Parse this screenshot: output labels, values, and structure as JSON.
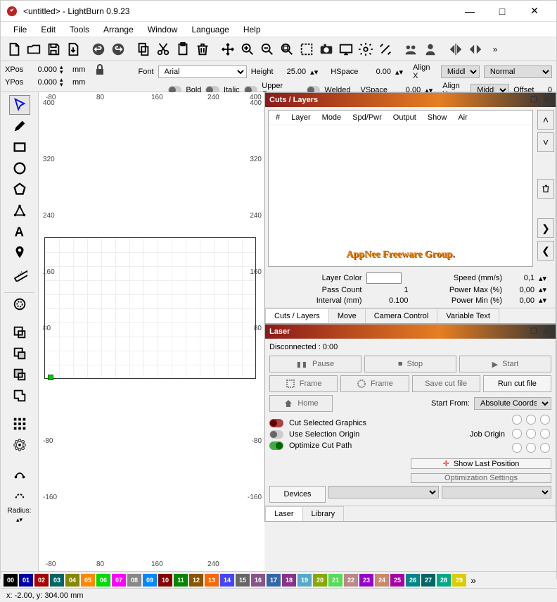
{
  "window": {
    "title": "<untitled> - LightBurn 0.9.23",
    "min": "—",
    "max": "□",
    "close": "✕"
  },
  "menu": [
    "File",
    "Edit",
    "Tools",
    "Arrange",
    "Window",
    "Language",
    "Help"
  ],
  "props": {
    "xpos_label": "XPos",
    "xpos_val": "0.000",
    "ypos_label": "YPos",
    "ypos_val": "0.000",
    "unit": "mm",
    "font_label": "Font",
    "font_value": "Arial",
    "height_label": "Height",
    "height_value": "25.00",
    "hspace_label": "HSpace",
    "hspace_value": "0.00",
    "vspace_label": "VSpace",
    "vspace_value": "0.00",
    "alignx_label": "Align X",
    "alignx_value": "Middle",
    "aligny_label": "Align Y",
    "aligny_value": "Middle",
    "normal": "Normal",
    "offset_label": "Offset",
    "offset_value": "0",
    "bold": "Bold",
    "italic": "Italic",
    "upper": "Upper Case",
    "welded": "Welded"
  },
  "palette_radius": "Radius:",
  "ruler_x": [
    "-80",
    "80",
    "160",
    "240",
    "400"
  ],
  "ruler_y_left": [
    "400",
    "320",
    "240",
    "160",
    "80",
    "",
    "-80",
    "-160"
  ],
  "ruler_y_right": [
    "400",
    "320",
    "240",
    "160",
    "80",
    "",
    "-80",
    "-160"
  ],
  "cuts": {
    "title": "Cuts / Layers",
    "headers": [
      "#",
      "Layer",
      "Mode",
      "Spd/Pwr",
      "Output",
      "Show",
      "Air"
    ],
    "watermark": "AppNee Freeware Group.",
    "layer_color": "Layer Color",
    "speed": "Speed (mm/s)",
    "speed_val": "0,1",
    "pass_count": "Pass Count",
    "pass_val": "1",
    "power_max": "Power Max (%)",
    "power_max_val": "0,00",
    "interval": "Interval (mm)",
    "interval_val": "0.100",
    "power_min": "Power Min (%)",
    "power_min_val": "0,00",
    "tabs": [
      "Cuts / Layers",
      "Move",
      "Camera Control",
      "Variable Text"
    ]
  },
  "laser": {
    "title": "Laser",
    "status": "Disconnected : 0:00",
    "pause": "Pause",
    "stop": "Stop",
    "start": "Start",
    "frame1": "Frame",
    "frame2": "Frame",
    "save_cut": "Save cut file",
    "run_cut": "Run cut file",
    "home": "Home",
    "start_from": "Start From:",
    "start_from_val": "Absolute Coords",
    "job_origin": "Job Origin",
    "cut_selected": "Cut Selected Graphics",
    "use_selection": "Use Selection Origin",
    "show_last": "Show Last Position",
    "optimize": "Optimize Cut Path",
    "opt_settings": "Optimization Settings",
    "devices": "Devices",
    "tabs": [
      "Laser",
      "Library"
    ]
  },
  "colors": [
    {
      "n": "00",
      "c": "#000"
    },
    {
      "n": "01",
      "c": "#00a"
    },
    {
      "n": "02",
      "c": "#a00"
    },
    {
      "n": "03",
      "c": "#066"
    },
    {
      "n": "04",
      "c": "#880"
    },
    {
      "n": "05",
      "c": "#f80"
    },
    {
      "n": "06",
      "c": "#0d0"
    },
    {
      "n": "07",
      "c": "#f0f"
    },
    {
      "n": "08",
      "c": "#888"
    },
    {
      "n": "09",
      "c": "#08f"
    },
    {
      "n": "10",
      "c": "#800"
    },
    {
      "n": "11",
      "c": "#080"
    },
    {
      "n": "12",
      "c": "#850"
    },
    {
      "n": "13",
      "c": "#f60"
    },
    {
      "n": "14",
      "c": "#44f"
    },
    {
      "n": "15",
      "c": "#666"
    },
    {
      "n": "16",
      "c": "#858"
    },
    {
      "n": "17",
      "c": "#36a"
    },
    {
      "n": "18",
      "c": "#838"
    },
    {
      "n": "19",
      "c": "#5ac"
    },
    {
      "n": "20",
      "c": "#8a0"
    },
    {
      "n": "21",
      "c": "#5d5"
    },
    {
      "n": "22",
      "c": "#b88"
    },
    {
      "n": "23",
      "c": "#90c"
    },
    {
      "n": "24",
      "c": "#c86"
    },
    {
      "n": "25",
      "c": "#a0a"
    },
    {
      "n": "26",
      "c": "#088"
    },
    {
      "n": "27",
      "c": "#066"
    },
    {
      "n": "28",
      "c": "#0a8"
    },
    {
      "n": "29",
      "c": "#dc0"
    }
  ],
  "statusbar": "x: -2.00, y: 304.00 mm"
}
